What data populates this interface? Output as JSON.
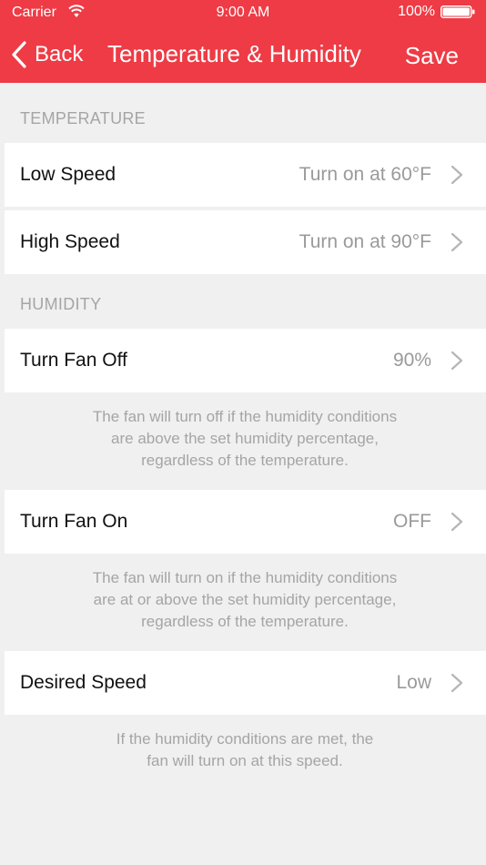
{
  "status_bar": {
    "carrier": "Carrier",
    "time": "9:00 AM",
    "battery": "100%"
  },
  "nav": {
    "back_label": "Back",
    "title": "Temperature & Humidity",
    "save_label": "Save"
  },
  "colors": {
    "accent": "#ee3b45",
    "background": "#f0f0f0"
  },
  "temperature": {
    "header": "TEMPERATURE",
    "rows": [
      {
        "label": "Low Speed",
        "value": "Turn on at 60°F"
      },
      {
        "label": "High Speed",
        "value": "Turn on at 90°F"
      }
    ]
  },
  "humidity": {
    "header": "HUMIDITY",
    "fan_off": {
      "label": "Turn Fan Off",
      "value": "90%",
      "note_lines": [
        "The fan will turn off if the humidity conditions",
        "are above the set humidity percentage,",
        "regardless of the temperature."
      ]
    },
    "fan_on": {
      "label": "Turn Fan On",
      "value": "OFF",
      "note_lines": [
        "The fan will turn on if the humidity conditions",
        "are at or above the set humidity percentage,",
        "regardless of the temperature."
      ]
    },
    "desired_speed": {
      "label": "Desired Speed",
      "value": "Low",
      "note_lines": [
        "If the humidity conditions are met, the",
        "fan will turn on at this speed."
      ]
    }
  }
}
